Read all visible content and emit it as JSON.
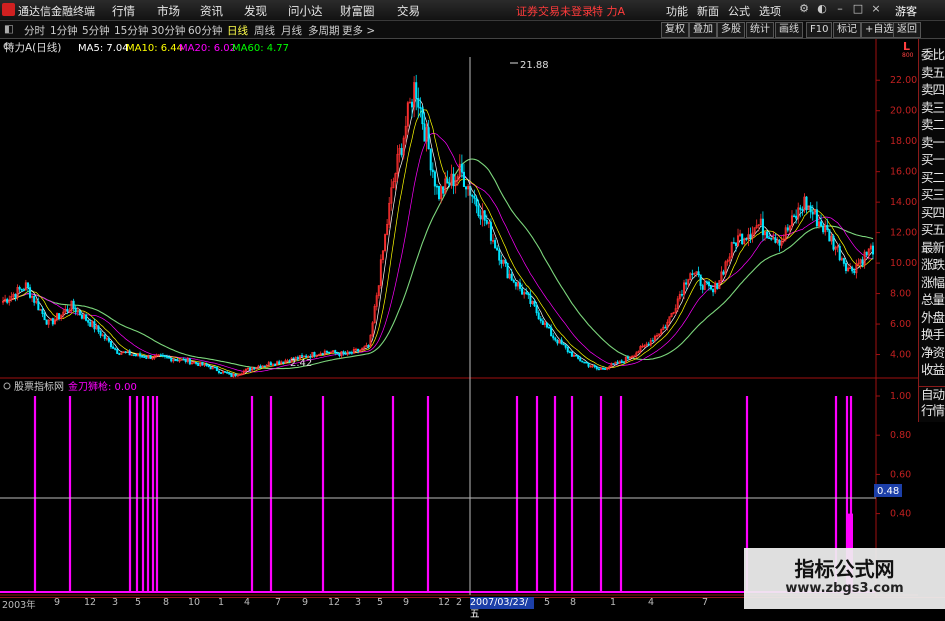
{
  "menubar": {
    "app_name": "通达信金融终端",
    "items": [
      "行情",
      "市场",
      "资讯",
      "发现",
      "问小达",
      "财富圈",
      "交易"
    ],
    "warning": "证券交易未登录",
    "stock": "特 力A",
    "right_items": [
      "功能",
      "新面",
      "公式",
      "选项"
    ],
    "user": "游客"
  },
  "periodbar": {
    "periods": [
      "分时",
      "1分钟",
      "5分钟",
      "15分钟",
      "30分钟",
      "60分钟",
      "日线",
      "周线",
      "月线",
      "多周期",
      "更多 >"
    ],
    "active": "日线",
    "tools": [
      "复权",
      "叠加",
      "多股",
      "统计",
      "画线",
      "F10",
      "标记",
      "+自选",
      "返回"
    ]
  },
  "main_chart": {
    "title": "特力A(日线)",
    "ma5": "MA5: 7.04",
    "ma10": "MA10: 6.44",
    "ma20": "MA20: 6.02",
    "ma60": "MA60: 4.77",
    "high_label": "21.88",
    "low_label": "2.42",
    "scale_indicator": "L",
    "scale_indicator_sub": "800",
    "y_ticks": [
      "22.00",
      "20.00",
      "18.00",
      "16.00",
      "14.00",
      "12.00",
      "10.00",
      "8.00",
      "6.00",
      "4.00"
    ]
  },
  "indicator": {
    "name": "股票指标网",
    "label": "金刀狮枪: 0.00",
    "y_ticks": [
      "1.00",
      "0.80",
      "0.60",
      "0.40"
    ],
    "cursor_value": "0.48"
  },
  "right_panel": {
    "items": [
      "委比",
      "卖五",
      "卖四",
      "卖三",
      "卖二",
      "卖一",
      "买一",
      "买二",
      "买三",
      "买四",
      "买五",
      "最新",
      "涨跌",
      "涨幅",
      "总量",
      "外盘",
      "换手",
      "净资",
      "收益"
    ],
    "bottom_items": [
      "自动",
      "行情"
    ]
  },
  "bottom_axis": {
    "labels": [
      "2003年",
      "9",
      "12",
      "3",
      "5",
      "8",
      "10",
      "1",
      "4",
      "7",
      "9",
      "12",
      "3",
      "5",
      "9",
      "12",
      "2",
      "5",
      "8",
      "1",
      "4",
      "7"
    ],
    "current_date": "2007/03/23/五"
  },
  "watermark": {
    "title": "指标公式网",
    "url": "www.zbgs3.com"
  },
  "colors": {
    "ma5": "#ffffff",
    "ma10": "#ffff00",
    "ma20": "#ff00ff",
    "ma60": "#00ff00",
    "up": "#ff3030",
    "down": "#00e5ff",
    "indicator": "#ff00ff",
    "axis": "#a01010"
  },
  "chart_data": [
    {
      "type": "candlestick",
      "title": "特力A(日线)",
      "ylim": [
        2,
        23
      ],
      "x": [
        "2003",
        "2003-09",
        "2003-12",
        "2004-03",
        "2004-05",
        "2004-08",
        "2004-10",
        "2005-01",
        "2005-04",
        "2005-07",
        "2005-09",
        "2005-12",
        "2006-03",
        "2006-05",
        "2006-09",
        "2006-12",
        "2007-02",
        "2007-05",
        "2007-08",
        "2008-01",
        "2008-04",
        "2008-07"
      ],
      "series": [
        {
          "name": "close_trend",
          "values": [
            7.5,
            8.5,
            6.0,
            7.2,
            5.8,
            4.2,
            3.9,
            3.8,
            3.6,
            3.2,
            2.6,
            3.2,
            3.5,
            3.8,
            4.2,
            4.0,
            4.5,
            15.0,
            21.8,
            14.5,
            16.0,
            13.0,
            9.5,
            7.5,
            5.2,
            3.8,
            3.0,
            3.5,
            4.5,
            6.0,
            9.5,
            8.0,
            11.5,
            12.5,
            11.5,
            14.0,
            12.0,
            9.5,
            11.0
          ]
        }
      ]
    },
    {
      "type": "bar",
      "title": "金刀狮枪",
      "ylim": [
        0,
        1.05
      ],
      "note": "signal spikes",
      "values": [
        1,
        1,
        1,
        1,
        1,
        1,
        1,
        1,
        1,
        1,
        1,
        1,
        1,
        1,
        1,
        1,
        1,
        1,
        1,
        1,
        1,
        1,
        1,
        1
      ]
    }
  ]
}
